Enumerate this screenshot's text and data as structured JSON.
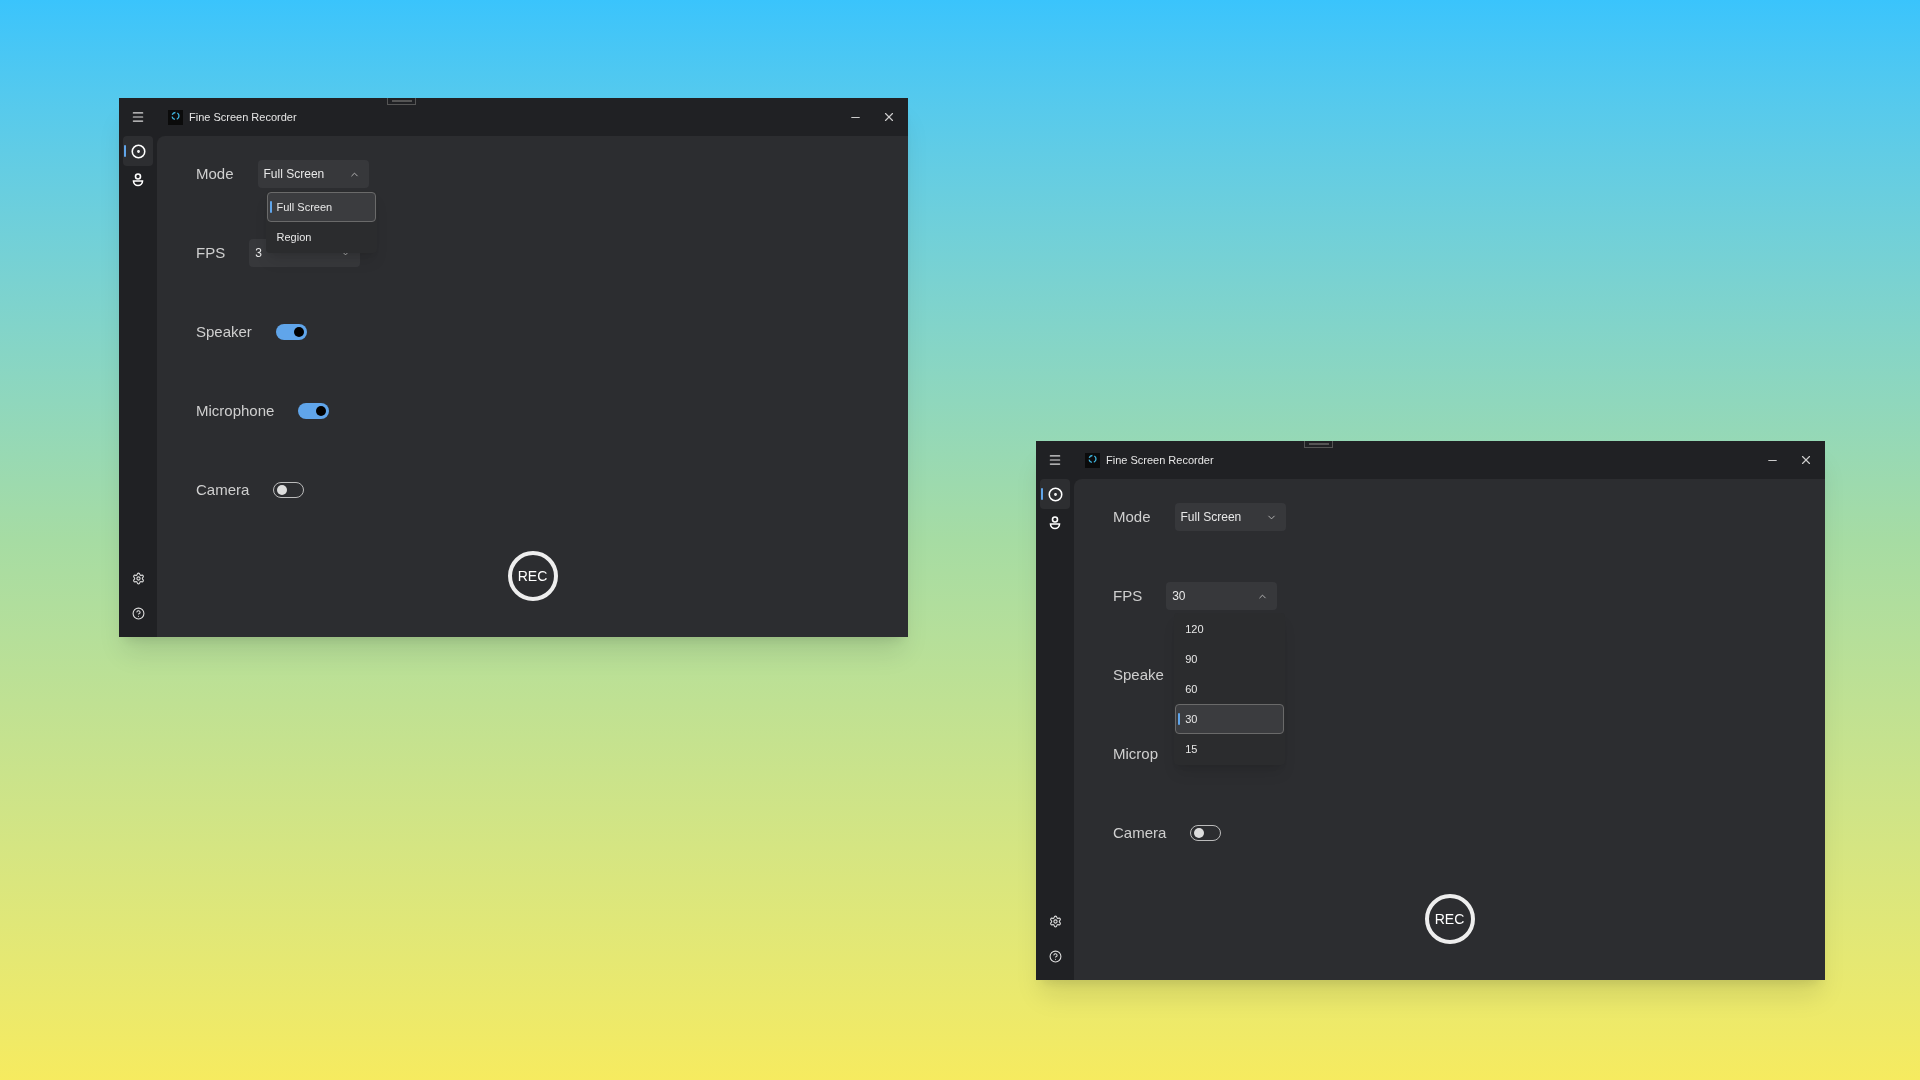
{
  "windows": [
    {
      "title": "Fine Screen Recorder",
      "nav": [
        {
          "kind": "record",
          "selected": true
        },
        {
          "kind": "person",
          "selected": false
        }
      ],
      "rows": [
        {
          "kind": "dropdown",
          "label": "Mode",
          "value": "Full Screen",
          "expanded": true,
          "options": [
            {
              "label": "Full Screen",
              "selected": true
            },
            {
              "label": "Region",
              "selected": false
            }
          ]
        },
        {
          "kind": "dropdown",
          "label": "FPS",
          "value": "3",
          "expanded": false
        },
        {
          "kind": "toggle",
          "label": "Speaker",
          "on": true
        },
        {
          "kind": "toggle",
          "label": "Microphone",
          "on": true
        },
        {
          "kind": "toggle",
          "label": "Camera",
          "on": false
        }
      ],
      "record_button": "REC"
    },
    {
      "title": "Fine Screen Recorder",
      "nav": [
        {
          "kind": "record",
          "selected": true
        },
        {
          "kind": "person",
          "selected": false
        }
      ],
      "rows": [
        {
          "kind": "dropdown",
          "label": "Mode",
          "value": "Full Screen",
          "expanded": false
        },
        {
          "kind": "dropdown",
          "label": "FPS",
          "value": "30",
          "expanded": true,
          "options": [
            {
              "label": "120",
              "selected": false
            },
            {
              "label": "90",
              "selected": false
            },
            {
              "label": "60",
              "selected": false
            },
            {
              "label": "30",
              "selected": true
            },
            {
              "label": "15",
              "selected": false
            }
          ]
        },
        {
          "kind": "toggle",
          "label": "Speake"
        },
        {
          "kind": "toggle",
          "label": "Microp"
        },
        {
          "kind": "toggle",
          "label": "Camera",
          "on": false
        }
      ],
      "record_button": "REC"
    }
  ]
}
